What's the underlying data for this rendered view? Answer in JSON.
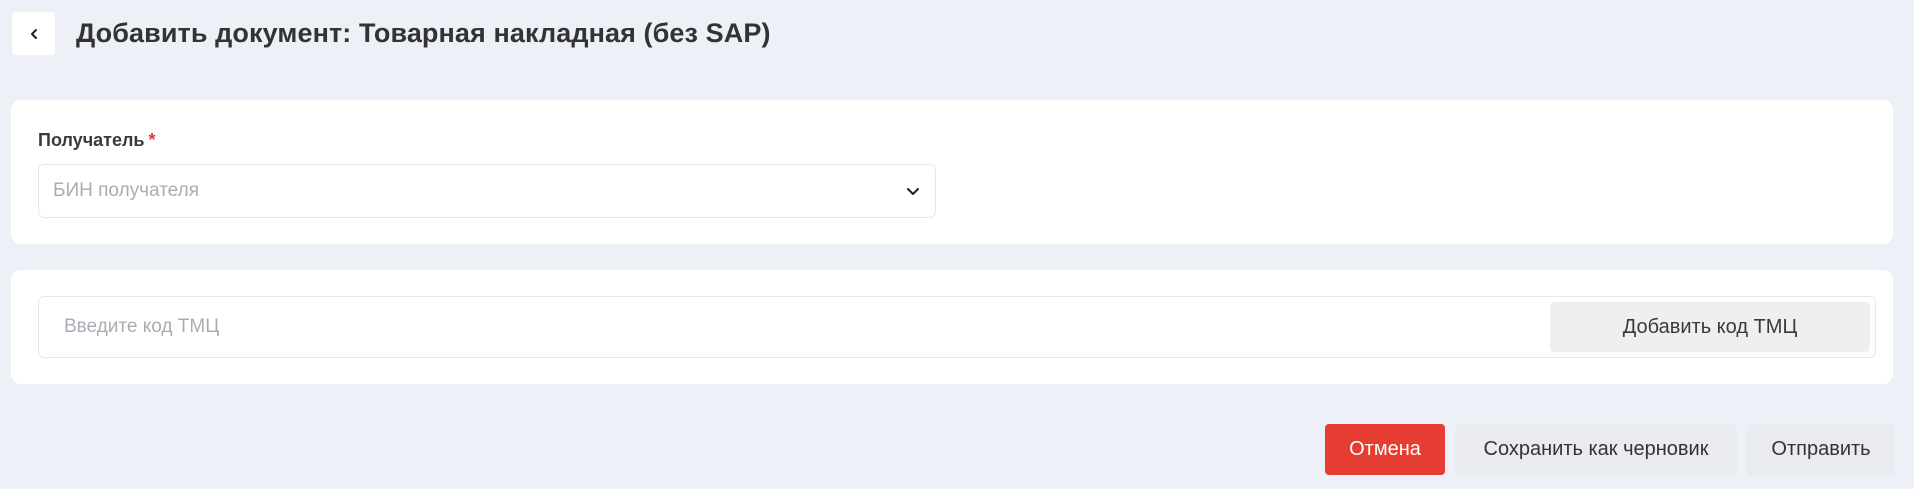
{
  "header": {
    "back_icon": "chevron-left-icon",
    "title": "Добавить документ: Товарная накладная (без SAP)"
  },
  "recipient": {
    "label": "Получатель",
    "required_marker": "*",
    "select_placeholder": "БИН получателя",
    "select_icon": "chevron-down-icon"
  },
  "code": {
    "input_placeholder": "Введите код ТМЦ",
    "add_button_label": "Добавить код ТМЦ"
  },
  "actions": {
    "cancel_label": "Отмена",
    "draft_label": "Сохранить как черновик",
    "send_label": "Отправить"
  },
  "colors": {
    "background": "#edf0f7",
    "danger": "#e53d32",
    "required": "#e53935"
  }
}
